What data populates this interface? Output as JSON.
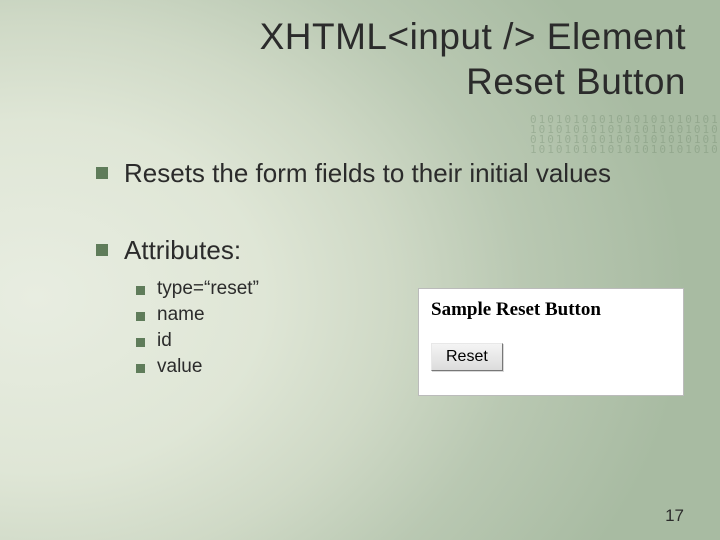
{
  "title_line1": "XHTML<input /> Element",
  "title_line2": "Reset Button",
  "bullets": {
    "b1": "Resets the form fields to their initial values",
    "b2": "Attributes:"
  },
  "sub_bullets": {
    "s1": "type=“reset”",
    "s2": "name",
    "s3": "id",
    "s4": "value"
  },
  "sample": {
    "heading": "Sample Reset Button",
    "button_label": "Reset"
  },
  "page_number": "17",
  "binary_deco": "0101010101010101010101\n1010101010101010101010\n0101010101010101010101\n1010101010101010101010"
}
